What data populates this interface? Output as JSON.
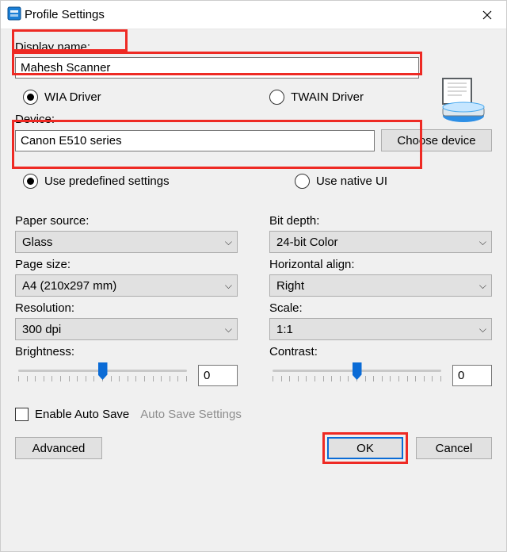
{
  "window": {
    "title": "Profile Settings"
  },
  "labels": {
    "display_name": "Display name:",
    "device": "Device:",
    "choose_device": "Choose device",
    "paper_source": "Paper source:",
    "page_size": "Page size:",
    "resolution": "Resolution:",
    "brightness": "Brightness:",
    "bit_depth": "Bit depth:",
    "horizontal_align": "Horizontal align:",
    "scale": "Scale:",
    "contrast": "Contrast:",
    "enable_auto_save": "Enable Auto Save",
    "auto_save_settings": "Auto Save Settings",
    "advanced": "Advanced",
    "ok": "OK",
    "cancel": "Cancel"
  },
  "radios": {
    "driver": {
      "wia": "WIA Driver",
      "twain": "TWAIN Driver",
      "selected": "wia"
    },
    "settings_mode": {
      "predefined": "Use predefined settings",
      "native": "Use native UI",
      "selected": "predefined"
    }
  },
  "values": {
    "display_name": "Mahesh Scanner",
    "device": "Canon E510 series",
    "paper_source": "Glass",
    "page_size": "A4 (210x297 mm)",
    "resolution": "300 dpi",
    "bit_depth": "24-bit Color",
    "horizontal_align": "Right",
    "scale": "1:1",
    "brightness": "0",
    "contrast": "0",
    "enable_auto_save": false
  }
}
